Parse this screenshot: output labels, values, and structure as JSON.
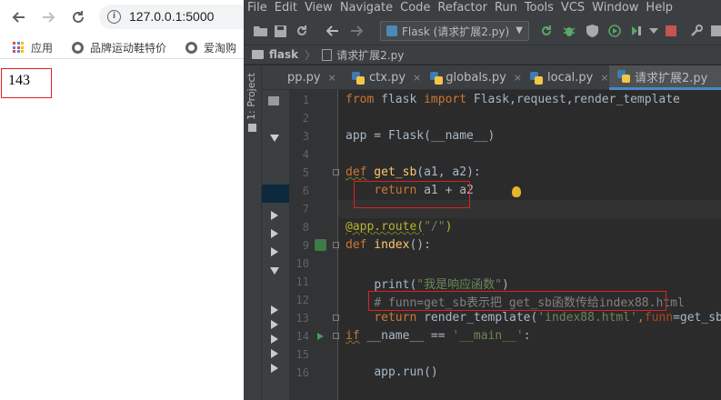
{
  "browser": {
    "url": "127.0.0.1:5000",
    "bookmarks": [
      {
        "icon": "apps-icon",
        "label": "应用"
      },
      {
        "icon": "globe-icon",
        "label": "品牌运动鞋特价"
      },
      {
        "icon": "globe-icon",
        "label": "爱淘购"
      }
    ],
    "page_output": "143"
  },
  "ide": {
    "menu": [
      "File",
      "Edit",
      "View",
      "Navigate",
      "Code",
      "Refactor",
      "Run",
      "Tools",
      "VCS",
      "Window",
      "Help"
    ],
    "run_config": "Flask (请求扩展2.py)",
    "breadcrumb": {
      "project": "flask",
      "file": "请求扩展2.py"
    },
    "side_panel_label": "1: Project",
    "tabs": [
      {
        "label": "pp.py",
        "active": false
      },
      {
        "label": "ctx.py",
        "active": false
      },
      {
        "label": "globals.py",
        "active": false
      },
      {
        "label": "local.py",
        "active": false
      },
      {
        "label": "请求扩展2.py",
        "active": true
      }
    ],
    "line_numbers": [
      "1",
      "2",
      "3",
      "4",
      "5",
      "6",
      "7",
      "8",
      "9",
      "10",
      "11",
      "12",
      "13",
      "14",
      "15",
      "16"
    ],
    "code": {
      "l1": {
        "from": "from",
        "mod": " flask ",
        "import": "import",
        "rest": " Flask,request,render_template"
      },
      "l3": "app = Flask(__name__)",
      "l5": {
        "def": "def",
        "name": " get_sb",
        "args": "(a1, a2):"
      },
      "l6": {
        "ret": "return",
        "expr": " a1 + a2"
      },
      "l8": {
        "dec": "@app.route(",
        "arg": "\"/\"",
        "close": ")"
      },
      "l9": {
        "def": "def",
        "name": " index",
        "args": "():"
      },
      "l11": {
        "fn": "print(",
        "arg": "\"我是响应函数\"",
        "close": ")"
      },
      "l12": "# funn=get_sb表示把 get_sb函数传给index88.html",
      "l13": {
        "ret": "return",
        "mid": " render_template(",
        "arg": "'index88.html'",
        "comma": ",",
        "kw": "funn",
        "tail": "=get_sb)"
      },
      "l14": {
        "if": "if",
        "rest": " __name__ == ",
        "arg": "'__main__'",
        "colon": ":"
      },
      "l16": "app.run()"
    }
  }
}
